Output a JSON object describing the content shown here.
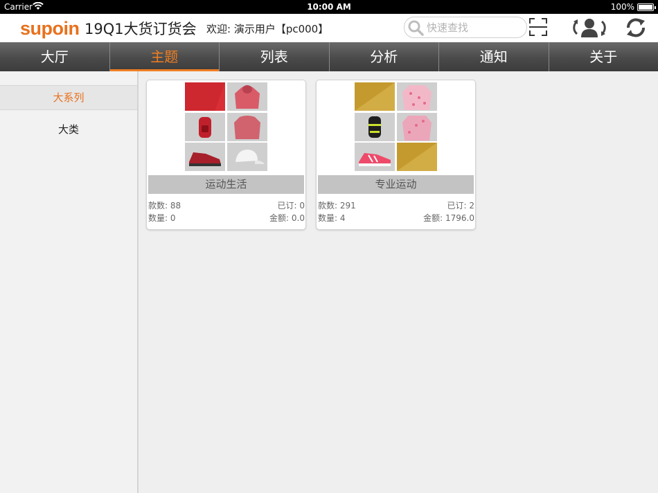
{
  "status_bar": {
    "carrier": "Carrier",
    "time": "10:00 AM",
    "battery": "100%"
  },
  "header": {
    "logo_text": "supoin",
    "title": "19Q1大货订货会",
    "welcome": "欢迎: 演示用户【pc000】",
    "search_placeholder": "快速查找"
  },
  "nav": {
    "tabs": [
      {
        "label": "大厅"
      },
      {
        "label": "主题"
      },
      {
        "label": "列表"
      },
      {
        "label": "分析"
      },
      {
        "label": "通知"
      },
      {
        "label": "关于"
      }
    ],
    "active_index": 1
  },
  "sidebar": {
    "items": [
      {
        "label": "大系列"
      },
      {
        "label": "大类"
      }
    ],
    "active_index": 0
  },
  "cards": [
    {
      "title": "运动生活",
      "styles_label": "款数: 88",
      "ordered_label": "已订: 0",
      "qty_label": "数量: 0",
      "amount_label": "金额: 0.0",
      "thumbs": [
        "red-swatch-image",
        "pink-hoodie-image",
        "red-backpack-image",
        "red-sneaker-image",
        "blank-tile",
        "white-cap-image"
      ]
    },
    {
      "title": "专业运动",
      "styles_label": "款数: 291",
      "ordered_label": "已订: 2",
      "qty_label": "数量: 4",
      "amount_label": "金额: 1796.0",
      "thumbs": [
        "gold-swatch-image",
        "pink-jacket-image",
        "black-backpack-image",
        "blank-tile",
        "pink-running-shoe-image",
        "gold-swatch-image"
      ]
    }
  ],
  "colors": {
    "accent": "#f07e22",
    "logo": "#e8711d",
    "nav_bg": "#4a4a4a",
    "card_title_bg": "#c3c3c3"
  },
  "icons": [
    "wifi-icon",
    "battery-icon",
    "search-icon",
    "scan-icon",
    "switch-user-icon",
    "refresh-icon"
  ]
}
